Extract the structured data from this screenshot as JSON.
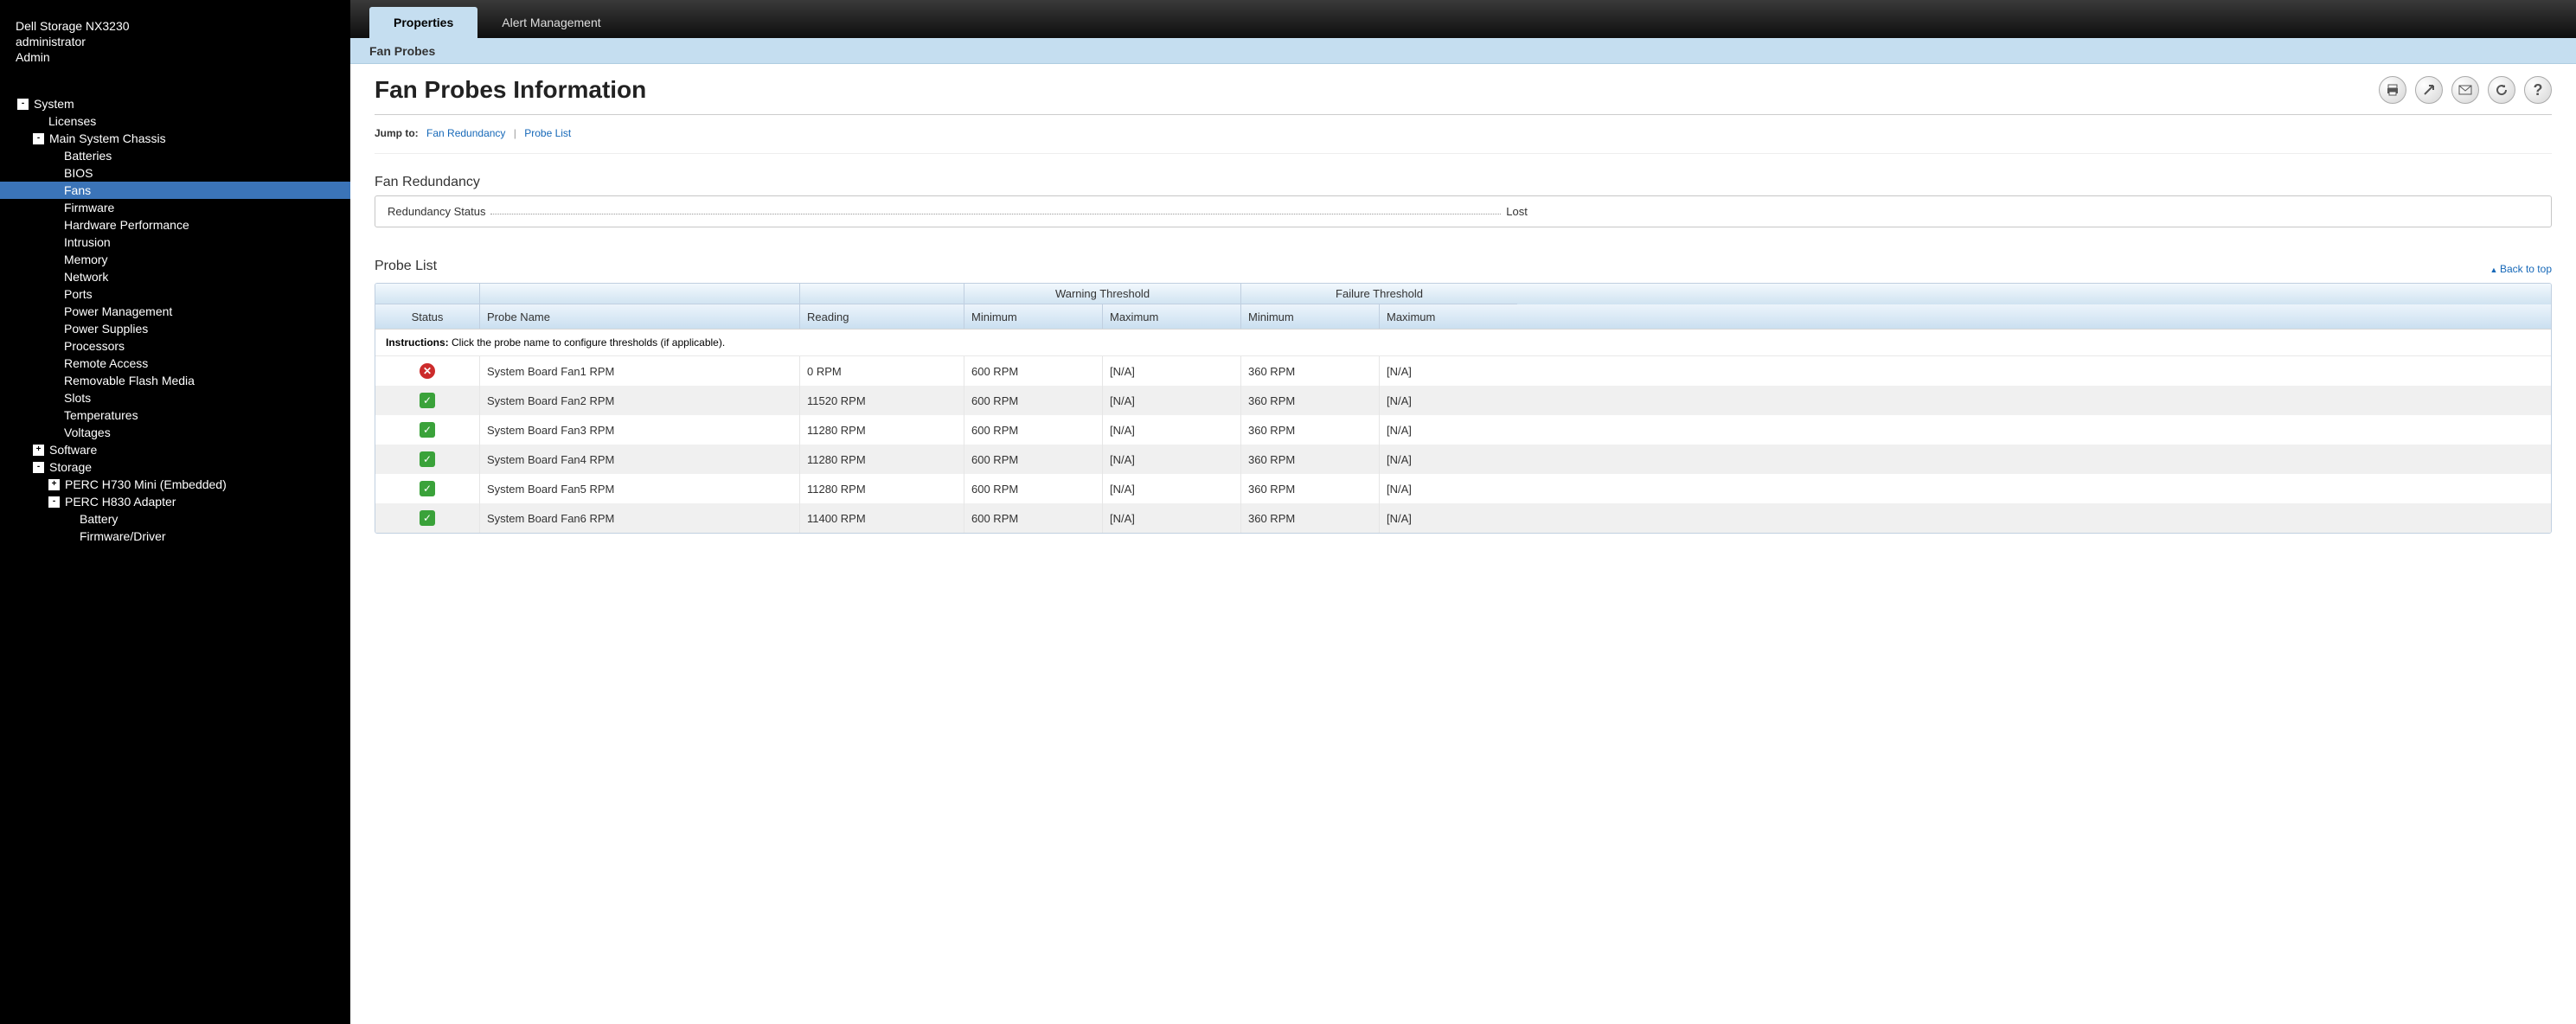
{
  "header": {
    "server": "Dell Storage NX3230",
    "user": "administrator",
    "role": "Admin"
  },
  "tree": [
    {
      "label": "System",
      "depth": 0,
      "expander": "-"
    },
    {
      "label": "Licenses",
      "depth": 1,
      "expander": ""
    },
    {
      "label": "Main System Chassis",
      "depth": 1,
      "expander": "-"
    },
    {
      "label": "Batteries",
      "depth": 2,
      "expander": ""
    },
    {
      "label": "BIOS",
      "depth": 2,
      "expander": ""
    },
    {
      "label": "Fans",
      "depth": 2,
      "expander": "",
      "selected": true
    },
    {
      "label": "Firmware",
      "depth": 2,
      "expander": ""
    },
    {
      "label": "Hardware Performance",
      "depth": 2,
      "expander": ""
    },
    {
      "label": "Intrusion",
      "depth": 2,
      "expander": ""
    },
    {
      "label": "Memory",
      "depth": 2,
      "expander": ""
    },
    {
      "label": "Network",
      "depth": 2,
      "expander": ""
    },
    {
      "label": "Ports",
      "depth": 2,
      "expander": ""
    },
    {
      "label": "Power Management",
      "depth": 2,
      "expander": ""
    },
    {
      "label": "Power Supplies",
      "depth": 2,
      "expander": ""
    },
    {
      "label": "Processors",
      "depth": 2,
      "expander": ""
    },
    {
      "label": "Remote Access",
      "depth": 2,
      "expander": ""
    },
    {
      "label": "Removable Flash Media",
      "depth": 2,
      "expander": ""
    },
    {
      "label": "Slots",
      "depth": 2,
      "expander": ""
    },
    {
      "label": "Temperatures",
      "depth": 2,
      "expander": ""
    },
    {
      "label": "Voltages",
      "depth": 2,
      "expander": ""
    },
    {
      "label": "Software",
      "depth": 1,
      "expander": "+"
    },
    {
      "label": "Storage",
      "depth": 1,
      "expander": "-"
    },
    {
      "label": "PERC H730 Mini (Embedded)",
      "depth": 2,
      "expander": "+"
    },
    {
      "label": "PERC H830 Adapter",
      "depth": 2,
      "expander": "-"
    },
    {
      "label": "Battery",
      "depth": 3,
      "expander": ""
    },
    {
      "label": "Firmware/Driver",
      "depth": 3,
      "expander": ""
    }
  ],
  "tabs": {
    "properties": "Properties",
    "alert": "Alert Management"
  },
  "subhead": "Fan Probes",
  "page_title": "Fan Probes Information",
  "jump": {
    "label": "Jump to:",
    "link1": "Fan Redundancy",
    "link2": "Probe List"
  },
  "redundancy": {
    "title": "Fan Redundancy",
    "status_label": "Redundancy Status",
    "status_value": "Lost"
  },
  "probe_list": {
    "title": "Probe List",
    "back_top": "Back to top",
    "group_headers": {
      "warning": "Warning Threshold",
      "failure": "Failure Threshold"
    },
    "headers": {
      "status": "Status",
      "name": "Probe Name",
      "reading": "Reading",
      "wmin": "Minimum",
      "wmax": "Maximum",
      "fmin": "Minimum",
      "fmax": "Maximum"
    },
    "instructions_label": "Instructions:",
    "instructions_text": " Click the probe name to configure thresholds (if applicable).",
    "rows": [
      {
        "status": "err",
        "name": "System Board Fan1 RPM",
        "reading": "0 RPM",
        "wmin": "600 RPM",
        "wmax": "[N/A]",
        "fmin": "360 RPM",
        "fmax": "[N/A]"
      },
      {
        "status": "ok",
        "name": "System Board Fan2 RPM",
        "reading": "11520 RPM",
        "wmin": "600 RPM",
        "wmax": "[N/A]",
        "fmin": "360 RPM",
        "fmax": "[N/A]"
      },
      {
        "status": "ok",
        "name": "System Board Fan3 RPM",
        "reading": "11280 RPM",
        "wmin": "600 RPM",
        "wmax": "[N/A]",
        "fmin": "360 RPM",
        "fmax": "[N/A]"
      },
      {
        "status": "ok",
        "name": "System Board Fan4 RPM",
        "reading": "11280 RPM",
        "wmin": "600 RPM",
        "wmax": "[N/A]",
        "fmin": "360 RPM",
        "fmax": "[N/A]"
      },
      {
        "status": "ok",
        "name": "System Board Fan5 RPM",
        "reading": "11280 RPM",
        "wmin": "600 RPM",
        "wmax": "[N/A]",
        "fmin": "360 RPM",
        "fmax": "[N/A]"
      },
      {
        "status": "ok",
        "name": "System Board Fan6 RPM",
        "reading": "11400 RPM",
        "wmin": "600 RPM",
        "wmax": "[N/A]",
        "fmin": "360 RPM",
        "fmax": "[N/A]"
      }
    ]
  },
  "action_icons": [
    "print",
    "export",
    "email",
    "refresh",
    "help"
  ]
}
